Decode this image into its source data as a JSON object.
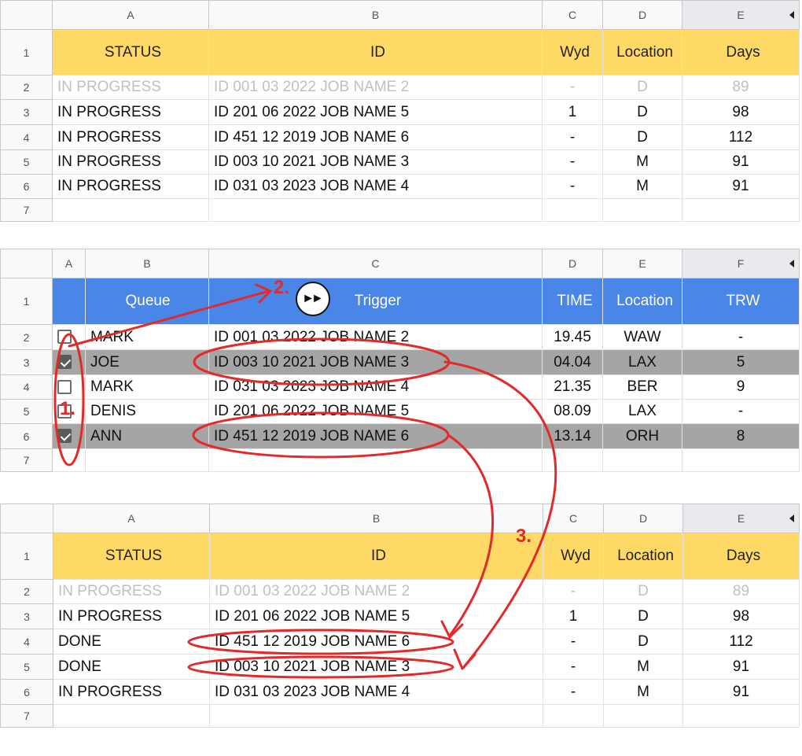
{
  "sheet1": {
    "columns": [
      "A",
      "B",
      "C",
      "D",
      "E"
    ],
    "header": {
      "status": "STATUS",
      "id": "ID",
      "wyd": "Wyd",
      "location": "Location",
      "days": "Days"
    },
    "rows": [
      {
        "n": "1"
      },
      {
        "n": "2",
        "status": "IN PROGRESS",
        "id": "ID 001 03 2022 JOB NAME 2",
        "wyd": "-",
        "location": "D",
        "days": "89"
      },
      {
        "n": "3",
        "status": "IN PROGRESS",
        "id": "ID 201 06 2022 JOB NAME 5",
        "wyd": "1",
        "location": "D",
        "days": "98"
      },
      {
        "n": "4",
        "status": "IN PROGRESS",
        "id": "ID 451 12 2019 JOB NAME 6",
        "wyd": "-",
        "location": "D",
        "days": "112"
      },
      {
        "n": "5",
        "status": "IN PROGRESS",
        "id": "ID 003 10 2021 JOB NAME 3",
        "wyd": "-",
        "location": "M",
        "days": "91"
      },
      {
        "n": "6",
        "status": "IN PROGRESS",
        "id": "ID 031 03 2023 JOB NAME 4",
        "wyd": "-",
        "location": "M",
        "days": "91"
      },
      {
        "n": "7"
      }
    ]
  },
  "sheet2": {
    "columns": [
      "A",
      "B",
      "C",
      "D",
      "E",
      "F"
    ],
    "header": {
      "queue": "Queue",
      "trigger": "Trigger",
      "time": "TIME",
      "location": "Location",
      "trw": "TRW"
    },
    "rows": [
      {
        "n": "1"
      },
      {
        "n": "2",
        "checked": false,
        "name": "MARK",
        "id": "ID 001 03 2022 JOB NAME 2",
        "time": "19.45",
        "location": "WAW",
        "trw": "-"
      },
      {
        "n": "3",
        "checked": true,
        "name": "JOE",
        "id": "ID 003 10 2021 JOB NAME 3",
        "time": "04.04",
        "location": "LAX",
        "trw": "5"
      },
      {
        "n": "4",
        "checked": false,
        "name": "MARK",
        "id": "ID 031 03 2023 JOB NAME 4",
        "time": "21.35",
        "location": "BER",
        "trw": "9"
      },
      {
        "n": "5",
        "checked": false,
        "name": "DENIS",
        "id": "ID 201 06 2022 JOB NAME 5",
        "time": "08.09",
        "location": "LAX",
        "trw": "-"
      },
      {
        "n": "6",
        "checked": true,
        "name": "ANN",
        "id": "ID 451 12 2019 JOB NAME 6",
        "time": "13.14",
        "location": "ORH",
        "trw": "8"
      },
      {
        "n": "7"
      }
    ]
  },
  "sheet3": {
    "columns": [
      "A",
      "B",
      "C",
      "D",
      "E"
    ],
    "header": {
      "status": "STATUS",
      "id": "ID",
      "wyd": "Wyd",
      "location": "Location",
      "days": "Days"
    },
    "rows": [
      {
        "n": "1"
      },
      {
        "n": "2",
        "status": "IN PROGRESS",
        "id": "ID 001 03 2022 JOB NAME 2",
        "wyd": "-",
        "location": "D",
        "days": "89"
      },
      {
        "n": "3",
        "status": "IN PROGRESS",
        "id": "ID 201 06 2022 JOB NAME 5",
        "wyd": "1",
        "location": "D",
        "days": "98"
      },
      {
        "n": "4",
        "status": "DONE",
        "id": "ID 451 12 2019 JOB NAME 6",
        "wyd": "-",
        "location": "D",
        "days": "112"
      },
      {
        "n": "5",
        "status": "DONE",
        "id": "ID 003 10 2021 JOB NAME 3",
        "wyd": "-",
        "location": "M",
        "days": "91"
      },
      {
        "n": "6",
        "status": "IN PROGRESS",
        "id": "ID 031 03 2023 JOB NAME 4",
        "wyd": "-",
        "location": "M",
        "days": "91"
      },
      {
        "n": "7"
      }
    ]
  },
  "annotations": {
    "step1": "1.",
    "step2": "2.",
    "step3": "3."
  },
  "icons": {
    "trigger": "fast-forward-icon",
    "checkbox": "checkbox-icon",
    "column_scroll": "triangle-left-icon"
  },
  "colors": {
    "header_yellow": "#ffd966",
    "header_blue": "#4a86e8",
    "selected_row_grey": "#a5a5a5",
    "annotation_red": "#e32a2a"
  }
}
